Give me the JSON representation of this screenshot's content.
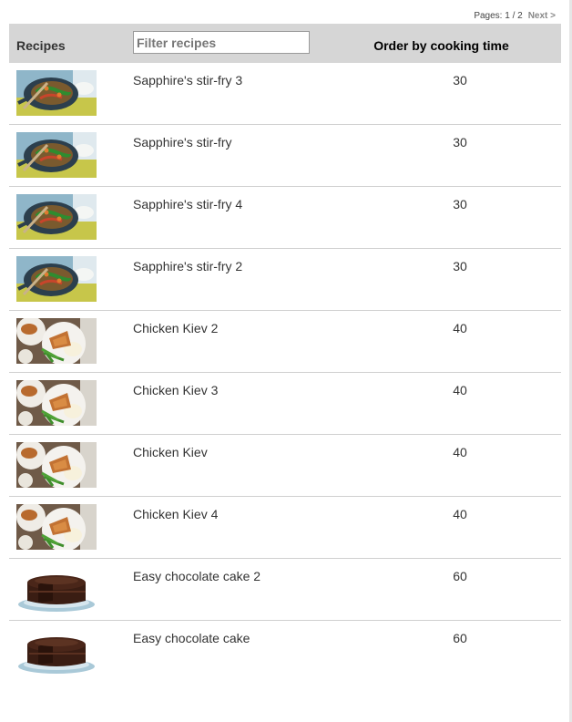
{
  "pager": {
    "label": "Pages: 1 / 2",
    "next_label": "Next >"
  },
  "header": {
    "recipes_label": "Recipes",
    "filter_placeholder": "Filter recipes",
    "order_label": "Order by cooking time"
  },
  "rows": [
    {
      "name": "Sapphire's stir-fry 3",
      "time": "30",
      "thumb": "stir-fry"
    },
    {
      "name": "Sapphire's stir-fry",
      "time": "30",
      "thumb": "stir-fry"
    },
    {
      "name": "Sapphire's stir-fry 4",
      "time": "30",
      "thumb": "stir-fry"
    },
    {
      "name": "Sapphire's stir-fry 2",
      "time": "30",
      "thumb": "stir-fry"
    },
    {
      "name": "Chicken Kiev 2",
      "time": "40",
      "thumb": "chicken-kiev"
    },
    {
      "name": "Chicken Kiev 3",
      "time": "40",
      "thumb": "chicken-kiev"
    },
    {
      "name": "Chicken Kiev",
      "time": "40",
      "thumb": "chicken-kiev"
    },
    {
      "name": "Chicken Kiev 4",
      "time": "40",
      "thumb": "chicken-kiev"
    },
    {
      "name": "Easy chocolate cake 2",
      "time": "60",
      "thumb": "chocolate-cake"
    },
    {
      "name": "Easy chocolate cake",
      "time": "60",
      "thumb": "chocolate-cake"
    }
  ]
}
